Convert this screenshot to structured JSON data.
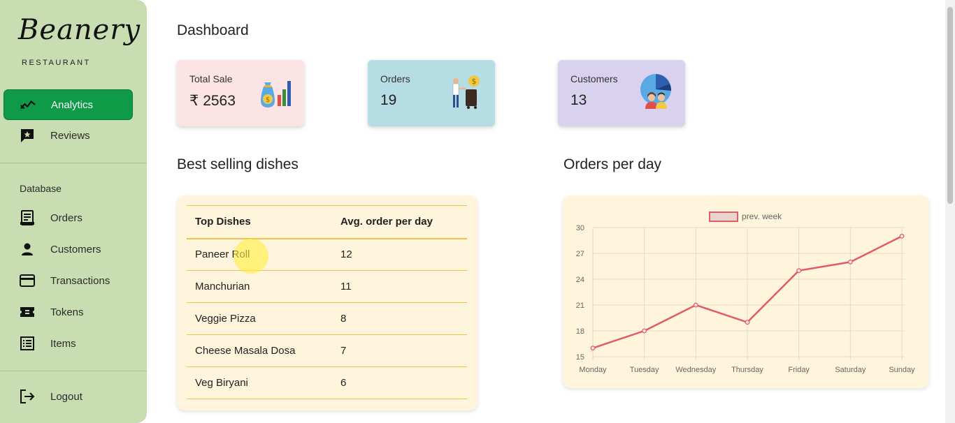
{
  "sidebar": {
    "logo_text": "Beanery",
    "logo_sub": "RESTAURANT",
    "primary_items": [
      {
        "label": "Analytics",
        "icon": "analytics-icon",
        "active": true
      },
      {
        "label": "Reviews",
        "icon": "review-icon",
        "active": false
      }
    ],
    "section_label": "Database",
    "db_items": [
      {
        "label": "Orders",
        "icon": "receipt-icon"
      },
      {
        "label": "Customers",
        "icon": "person-icon"
      },
      {
        "label": "Transactions",
        "icon": "credit-card-icon"
      },
      {
        "label": "Tokens",
        "icon": "ticket-icon"
      },
      {
        "label": "Items",
        "icon": "list-icon"
      }
    ],
    "logout_label": "Logout"
  },
  "main": {
    "title": "Dashboard",
    "cards": [
      {
        "label": "Total Sale",
        "value": "₹ 2563",
        "bg": "#fde4e4",
        "icon": "money-bag-chart-icon"
      },
      {
        "label": "Orders",
        "value": "19",
        "bg": "#b6dde3",
        "icon": "delivery-person-icon"
      },
      {
        "label": "Customers",
        "value": "13",
        "bg": "#d9d2ef",
        "icon": "customers-pie-icon"
      }
    ],
    "best_selling": {
      "title": "Best selling dishes",
      "columns": [
        "Top Dishes",
        "Avg. order per day"
      ],
      "rows": [
        [
          "Paneer Roll",
          "12"
        ],
        [
          "Manchurian",
          "11"
        ],
        [
          "Veggie Pizza",
          "8"
        ],
        [
          "Cheese Masala Dosa",
          "7"
        ],
        [
          "Veg Biryani",
          "6"
        ]
      ]
    },
    "orders_chart_title": "Orders per day"
  },
  "chart_data": {
    "type": "line",
    "categories": [
      "Monday",
      "Tuesday",
      "Wednesday",
      "Thursday",
      "Friday",
      "Saturday",
      "Sunday"
    ],
    "series": [
      {
        "name": "prev. week",
        "values": [
          16,
          18,
          21,
          19,
          25,
          26,
          29
        ],
        "color": "#e05a6a"
      }
    ],
    "yticks": [
      15,
      18,
      21,
      24,
      27,
      30
    ],
    "ylim": [
      15,
      30
    ],
    "grid": true,
    "legend": "top-center"
  },
  "colors": {
    "sidebar_bg": "#c8ddb1",
    "active_nav": "#0f9a48",
    "panel_bg": "#fff4dc",
    "table_line": "#f0c246",
    "line_color": "#e05a6a"
  }
}
